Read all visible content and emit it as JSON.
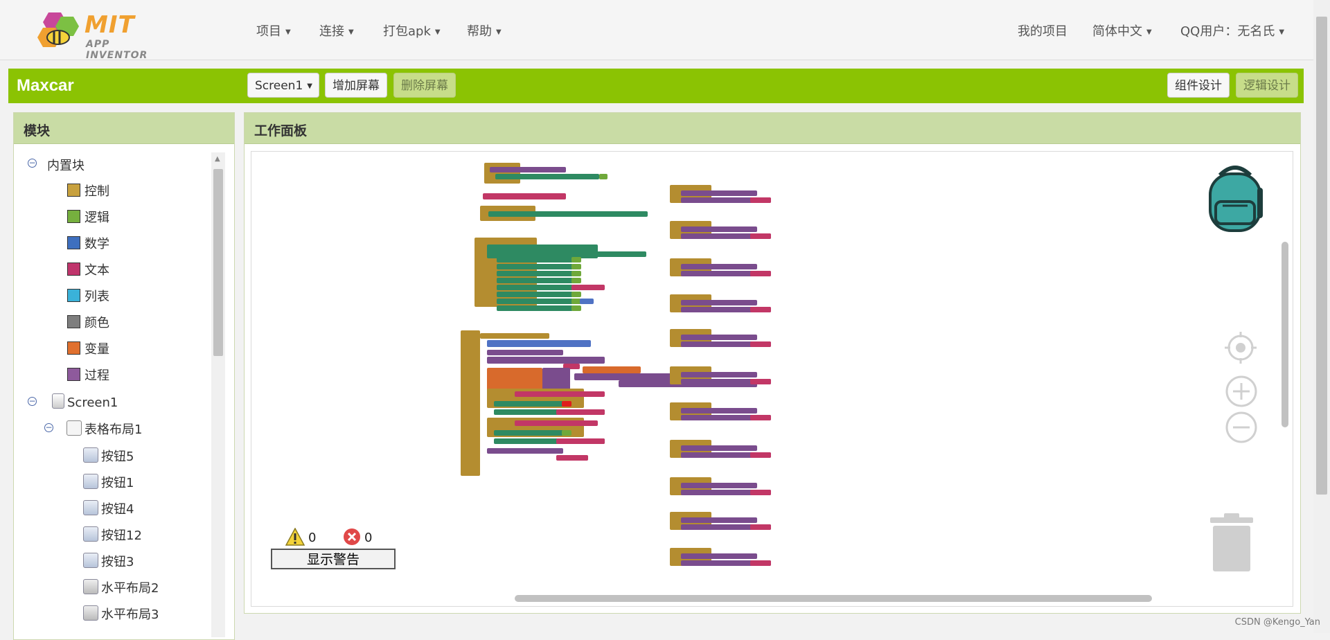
{
  "nav": {
    "logo_mit": "MIT",
    "logo_sub": "APP INVENTOR",
    "menu": [
      "项目",
      "连接",
      "打包apk",
      "帮助"
    ],
    "my_projects": "我的项目",
    "language": "简体中文",
    "user": "QQ用户：无名氏"
  },
  "toolbar": {
    "project_name": "Maxcar",
    "screen_select": "Screen1",
    "add_screen": "增加屏幕",
    "remove_screen": "删除屏幕",
    "designer": "组件设计",
    "blocks": "逻辑设计"
  },
  "blocks_panel": {
    "title": "模块",
    "builtin": "内置块",
    "categories": [
      {
        "label": "控制",
        "color": "#c8a13e"
      },
      {
        "label": "逻辑",
        "color": "#76b03e"
      },
      {
        "label": "数学",
        "color": "#3e6fbf"
      },
      {
        "label": "文本",
        "color": "#c0356c"
      },
      {
        "label": "列表",
        "color": "#3ab2d9"
      },
      {
        "label": "颜色",
        "color": "#7e7e7e"
      },
      {
        "label": "变量",
        "color": "#e0702e"
      },
      {
        "label": "过程",
        "color": "#8e5a9c"
      }
    ],
    "screen": "Screen1",
    "layout": "表格布局1",
    "components": [
      "按钮5",
      "按钮1",
      "按钮4",
      "按钮12",
      "按钮3"
    ],
    "hlayouts": [
      "水平布局2",
      "水平布局3"
    ]
  },
  "workspace": {
    "title": "工作面板",
    "warning_count": "0",
    "error_count": "0",
    "show_warnings": "显示警告"
  },
  "footer": "CSDN @Kengo_Yan"
}
